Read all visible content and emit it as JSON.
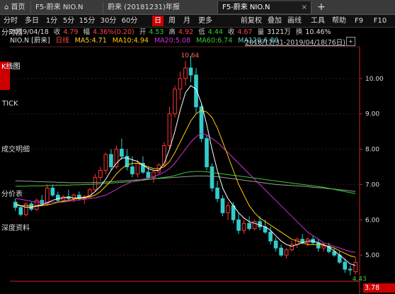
{
  "tabs": [
    {
      "label": "首页",
      "icon": "home-icon"
    },
    {
      "label": "F5-蔚来 NIO.N"
    },
    {
      "label": "蔚来 (20181231)年报"
    },
    {
      "label": "F5-蔚来 NIO.N",
      "active": true
    }
  ],
  "new_tab_symbol": "+",
  "toolbar": {
    "periods": [
      "分时",
      "多日",
      "1分",
      "5分",
      "15分",
      "30分",
      "60分",
      "日",
      "周",
      "月",
      "更多"
    ],
    "active_period": "日",
    "right": [
      "前复权",
      "叠加",
      "画线",
      "工具",
      "帮助",
      "F9",
      "F10"
    ]
  },
  "info": {
    "date": "2019/04/18",
    "close_label": "收",
    "close": "4.79",
    "change_label": "幅",
    "change": "4.36%(0.20)",
    "open_label": "开",
    "open": "4.53",
    "high_label": "高",
    "high": "4.92",
    "low_label": "低",
    "low": "4.44",
    "preclose_label": "收",
    "preclose": "4.67",
    "volume_label": "量",
    "volume": "3121万",
    "turnover_label": "换",
    "turnover": "10.46%"
  },
  "side_tabs": [
    "分时图",
    "K线图",
    "TICK",
    "成交明细",
    "分价表",
    "深度资料"
  ],
  "ma_line": {
    "symbol": "NIO.N [蔚来]",
    "period_label": "日线",
    "ma5": "MA5:4.71",
    "ma10": "MA10:4.94",
    "ma20": "MA20:5.08",
    "ma60": "MA60:6.74",
    "ma120": "MA120:6.80"
  },
  "date_range": "2018/12/31-2019/04/18(76日)",
  "range_button": "+",
  "price_tag": "3.78",
  "colors": {
    "up": "#ff3333",
    "down": "#33cccc",
    "ma5": "#ffffff",
    "ma10": "#ffcc00",
    "ma20": "#cc33cc",
    "ma60": "#33cc33",
    "ma120": "#999999"
  },
  "chart_data": {
    "type": "candlestick",
    "y_ticks": [
      5.0,
      6.0,
      7.0,
      8.0,
      9.0,
      10.0
    ],
    "y_range": [
      4.3,
      10.9
    ],
    "annotations": [
      {
        "label": "10.64",
        "kind": "high"
      },
      {
        "label": "4.43",
        "kind": "low"
      }
    ],
    "candles": [
      {
        "o": 6.5,
        "h": 6.6,
        "l": 6.25,
        "c": 6.35
      },
      {
        "o": 6.35,
        "h": 6.4,
        "l": 6.1,
        "c": 6.15
      },
      {
        "o": 6.15,
        "h": 6.5,
        "l": 6.1,
        "c": 6.45
      },
      {
        "o": 6.45,
        "h": 6.5,
        "l": 6.25,
        "c": 6.3
      },
      {
        "o": 6.3,
        "h": 6.6,
        "l": 6.25,
        "c": 6.55
      },
      {
        "o": 6.55,
        "h": 6.7,
        "l": 6.4,
        "c": 6.45
      },
      {
        "o": 6.45,
        "h": 7.0,
        "l": 6.4,
        "c": 6.9
      },
      {
        "o": 6.9,
        "h": 7.0,
        "l": 6.65,
        "c": 6.7
      },
      {
        "o": 6.7,
        "h": 6.8,
        "l": 6.5,
        "c": 6.55
      },
      {
        "o": 6.55,
        "h": 6.7,
        "l": 6.5,
        "c": 6.65
      },
      {
        "o": 6.65,
        "h": 6.85,
        "l": 6.55,
        "c": 6.6
      },
      {
        "o": 6.6,
        "h": 6.75,
        "l": 6.5,
        "c": 6.7
      },
      {
        "o": 6.7,
        "h": 6.8,
        "l": 6.55,
        "c": 6.6
      },
      {
        "o": 6.6,
        "h": 6.7,
        "l": 6.45,
        "c": 6.65
      },
      {
        "o": 6.65,
        "h": 6.9,
        "l": 6.6,
        "c": 6.85
      },
      {
        "o": 6.85,
        "h": 7.3,
        "l": 6.8,
        "c": 7.2
      },
      {
        "o": 7.2,
        "h": 7.5,
        "l": 7.1,
        "c": 7.4
      },
      {
        "o": 7.4,
        "h": 7.9,
        "l": 7.3,
        "c": 7.85
      },
      {
        "o": 7.85,
        "h": 8.0,
        "l": 7.4,
        "c": 7.5
      },
      {
        "o": 7.5,
        "h": 8.1,
        "l": 7.45,
        "c": 8.0
      },
      {
        "o": 8.0,
        "h": 8.3,
        "l": 7.7,
        "c": 7.8
      },
      {
        "o": 7.8,
        "h": 8.0,
        "l": 7.4,
        "c": 7.5
      },
      {
        "o": 7.5,
        "h": 7.8,
        "l": 7.2,
        "c": 7.3
      },
      {
        "o": 7.3,
        "h": 7.7,
        "l": 7.2,
        "c": 7.6
      },
      {
        "o": 7.6,
        "h": 7.8,
        "l": 7.3,
        "c": 7.35
      },
      {
        "o": 7.35,
        "h": 7.5,
        "l": 7.15,
        "c": 7.2
      },
      {
        "o": 7.2,
        "h": 7.4,
        "l": 7.05,
        "c": 7.35
      },
      {
        "o": 7.35,
        "h": 7.6,
        "l": 7.3,
        "c": 7.55
      },
      {
        "o": 7.55,
        "h": 8.2,
        "l": 7.5,
        "c": 8.1
      },
      {
        "o": 8.1,
        "h": 9.2,
        "l": 8.0,
        "c": 9.0
      },
      {
        "o": 9.0,
        "h": 9.8,
        "l": 8.9,
        "c": 9.7
      },
      {
        "o": 9.7,
        "h": 10.2,
        "l": 9.4,
        "c": 10.0
      },
      {
        "o": 10.0,
        "h": 10.5,
        "l": 9.8,
        "c": 10.3
      },
      {
        "o": 10.3,
        "h": 10.64,
        "l": 9.9,
        "c": 10.1
      },
      {
        "o": 10.1,
        "h": 10.3,
        "l": 9.0,
        "c": 9.2
      },
      {
        "o": 9.2,
        "h": 9.3,
        "l": 8.2,
        "c": 8.3
      },
      {
        "o": 8.3,
        "h": 8.4,
        "l": 7.4,
        "c": 7.5
      },
      {
        "o": 7.5,
        "h": 7.6,
        "l": 6.8,
        "c": 6.9
      },
      {
        "o": 6.9,
        "h": 7.1,
        "l": 6.5,
        "c": 6.6
      },
      {
        "o": 6.6,
        "h": 6.7,
        "l": 6.1,
        "c": 6.2
      },
      {
        "o": 6.2,
        "h": 6.5,
        "l": 6.0,
        "c": 6.4
      },
      {
        "o": 6.4,
        "h": 6.5,
        "l": 5.9,
        "c": 6.0
      },
      {
        "o": 6.0,
        "h": 6.2,
        "l": 5.6,
        "c": 5.7
      },
      {
        "o": 5.7,
        "h": 6.0,
        "l": 5.6,
        "c": 5.9
      },
      {
        "o": 5.9,
        "h": 6.1,
        "l": 5.7,
        "c": 5.75
      },
      {
        "o": 5.75,
        "h": 6.0,
        "l": 5.7,
        "c": 5.95
      },
      {
        "o": 5.95,
        "h": 6.1,
        "l": 5.7,
        "c": 5.8
      },
      {
        "o": 5.8,
        "h": 6.0,
        "l": 5.6,
        "c": 5.65
      },
      {
        "o": 5.65,
        "h": 5.8,
        "l": 5.3,
        "c": 5.4
      },
      {
        "o": 5.4,
        "h": 5.5,
        "l": 5.1,
        "c": 5.2
      },
      {
        "o": 5.2,
        "h": 5.3,
        "l": 4.95,
        "c": 5.0
      },
      {
        "o": 5.0,
        "h": 5.2,
        "l": 4.9,
        "c": 5.15
      },
      {
        "o": 5.15,
        "h": 5.4,
        "l": 5.1,
        "c": 5.3
      },
      {
        "o": 5.3,
        "h": 5.5,
        "l": 5.2,
        "c": 5.45
      },
      {
        "o": 5.45,
        "h": 5.6,
        "l": 5.3,
        "c": 5.35
      },
      {
        "o": 5.35,
        "h": 5.5,
        "l": 5.25,
        "c": 5.45
      },
      {
        "o": 5.45,
        "h": 5.55,
        "l": 5.3,
        "c": 5.35
      },
      {
        "o": 5.35,
        "h": 5.45,
        "l": 5.1,
        "c": 5.2
      },
      {
        "o": 5.2,
        "h": 5.35,
        "l": 5.1,
        "c": 5.25
      },
      {
        "o": 5.25,
        "h": 5.35,
        "l": 5.05,
        "c": 5.1
      },
      {
        "o": 5.1,
        "h": 5.2,
        "l": 4.95,
        "c": 5.0
      },
      {
        "o": 5.0,
        "h": 5.1,
        "l": 4.75,
        "c": 4.8
      },
      {
        "o": 4.8,
        "h": 4.9,
        "l": 4.5,
        "c": 4.6
      },
      {
        "o": 4.6,
        "h": 4.7,
        "l": 4.43,
        "c": 4.59
      },
      {
        "o": 4.53,
        "h": 4.92,
        "l": 4.44,
        "c": 4.79
      }
    ],
    "ma5": [
      6.45,
      6.4,
      6.35,
      6.35,
      6.4,
      6.42,
      6.48,
      6.55,
      6.6,
      6.62,
      6.65,
      6.62,
      6.62,
      6.64,
      6.68,
      6.8,
      6.95,
      7.15,
      7.4,
      7.6,
      7.75,
      7.75,
      7.7,
      7.65,
      7.55,
      7.45,
      7.4,
      7.4,
      7.6,
      8.0,
      8.5,
      9.1,
      9.6,
      9.8,
      9.7,
      9.3,
      8.7,
      8.0,
      7.4,
      6.9,
      6.6,
      6.4,
      6.2,
      6.05,
      5.95,
      5.9,
      5.85,
      5.8,
      5.7,
      5.55,
      5.4,
      5.3,
      5.25,
      5.3,
      5.35,
      5.4,
      5.4,
      5.35,
      5.3,
      5.22,
      5.12,
      5.0,
      4.88,
      4.75,
      4.71
    ],
    "ma10": [
      6.4,
      6.4,
      6.4,
      6.38,
      6.38,
      6.4,
      6.42,
      6.45,
      6.5,
      6.52,
      6.55,
      6.58,
      6.6,
      6.62,
      6.65,
      6.7,
      6.8,
      6.95,
      7.1,
      7.3,
      7.45,
      7.55,
      7.6,
      7.6,
      7.55,
      7.5,
      7.45,
      7.45,
      7.5,
      7.65,
      7.9,
      8.2,
      8.5,
      8.8,
      9.0,
      9.1,
      9.05,
      8.9,
      8.6,
      8.2,
      7.8,
      7.4,
      7.0,
      6.7,
      6.4,
      6.2,
      6.05,
      5.95,
      5.85,
      5.75,
      5.65,
      5.55,
      5.45,
      5.4,
      5.35,
      5.3,
      5.3,
      5.3,
      5.28,
      5.25,
      5.2,
      5.12,
      5.05,
      4.98,
      4.94
    ],
    "ma20": [
      6.6,
      6.58,
      6.55,
      6.52,
      6.5,
      6.5,
      6.5,
      6.5,
      6.5,
      6.5,
      6.52,
      6.54,
      6.56,
      6.58,
      6.6,
      6.62,
      6.66,
      6.7,
      6.78,
      6.86,
      6.95,
      7.02,
      7.08,
      7.12,
      7.15,
      7.18,
      7.22,
      7.28,
      7.35,
      7.45,
      7.6,
      7.8,
      8.0,
      8.2,
      8.35,
      8.45,
      8.4,
      8.3,
      8.2,
      8.05,
      7.9,
      7.75,
      7.6,
      7.45,
      7.3,
      7.15,
      7.0,
      6.85,
      6.7,
      6.55,
      6.4,
      6.25,
      6.1,
      5.95,
      5.8,
      5.65,
      5.55,
      5.45,
      5.35,
      5.3,
      5.25,
      5.2,
      5.15,
      5.1,
      5.08
    ],
    "ma60": [
      6.95,
      6.95,
      6.95,
      6.96,
      6.96,
      6.96,
      6.97,
      6.97,
      6.98,
      6.98,
      6.98,
      6.99,
      6.99,
      7.0,
      7.0,
      7.01,
      7.02,
      7.03,
      7.04,
      7.05,
      7.06,
      7.07,
      7.08,
      7.1,
      7.12,
      7.14,
      7.16,
      7.18,
      7.2,
      7.22,
      7.25,
      7.3,
      7.34,
      7.36,
      7.37,
      7.37,
      7.36,
      7.34,
      7.32,
      7.3,
      7.28,
      7.26,
      7.24,
      7.22,
      7.2,
      7.18,
      7.16,
      7.14,
      7.12,
      7.1,
      7.08,
      7.06,
      7.04,
      7.02,
      7.0,
      6.98,
      6.96,
      6.94,
      6.92,
      6.89,
      6.86,
      6.83,
      6.8,
      6.77,
      6.74
    ],
    "ma120": [
      7.1,
      7.1,
      7.09,
      7.09,
      7.08,
      7.08,
      7.07,
      7.07,
      7.06,
      7.06,
      7.05,
      7.05,
      7.05,
      7.05,
      7.05,
      7.06,
      7.06,
      7.07,
      7.08,
      7.09,
      7.1,
      7.11,
      7.12,
      7.13,
      7.14,
      7.15,
      7.16,
      7.17,
      7.18,
      7.19,
      7.2,
      7.21,
      7.22,
      7.23,
      7.24,
      7.24,
      7.24,
      7.23,
      7.22,
      7.2,
      7.18,
      7.16,
      7.14,
      7.12,
      7.1,
      7.08,
      7.06,
      7.04,
      7.02,
      7.0,
      6.99,
      6.98,
      6.97,
      6.96,
      6.95,
      6.94,
      6.92,
      6.91,
      6.9,
      6.88,
      6.87,
      6.85,
      6.84,
      6.82,
      6.8
    ]
  }
}
